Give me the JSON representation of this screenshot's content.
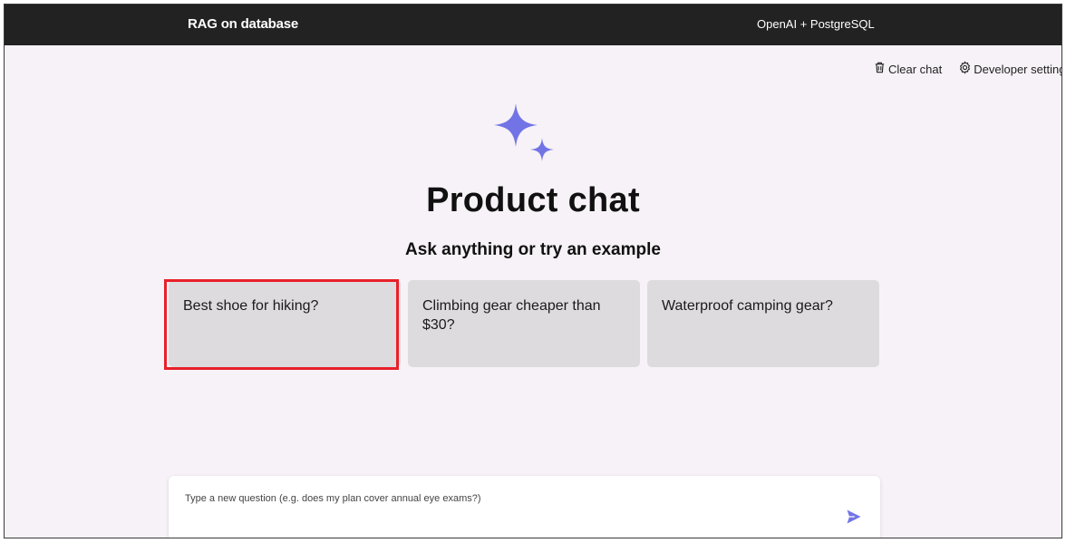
{
  "header": {
    "title": "RAG on database",
    "subtitle": "OpenAI + PostgreSQL"
  },
  "commands": {
    "clear_chat": "Clear chat",
    "developer_settings": "Developer settings"
  },
  "main": {
    "heading": "Product chat",
    "subheading": "Ask anything or try an example",
    "examples": [
      "Best shoe for hiking?",
      "Climbing gear cheaper than $30?",
      "Waterproof camping gear?"
    ]
  },
  "question": {
    "placeholder": "Type a new question (e.g. does my plan cover annual eye exams?)"
  },
  "colors": {
    "accent": "#7274e6",
    "header_bg": "#222222",
    "page_bg": "#f7f2f7",
    "example_bg": "#dedbde",
    "highlight": "#e8202a"
  },
  "icons": [
    "trash-icon",
    "gear-icon",
    "sparkle-icon",
    "send-icon"
  ]
}
